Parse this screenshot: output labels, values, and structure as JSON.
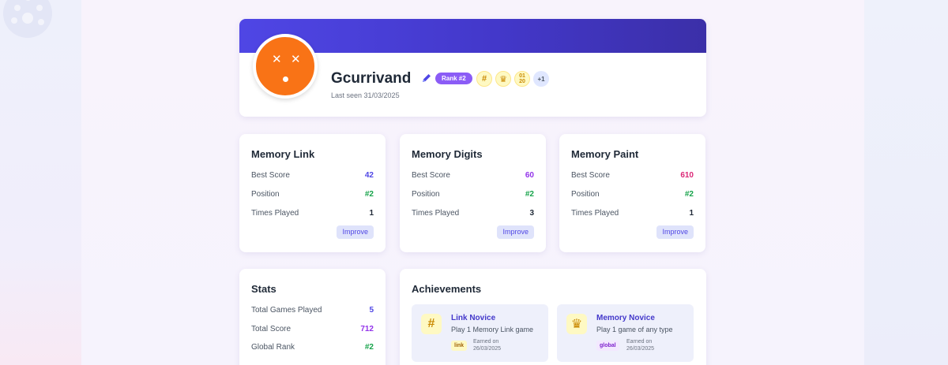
{
  "profile": {
    "username": "Gcurrivand",
    "rank_badge": "Rank #2",
    "last_seen": "Last seen 31/03/2025",
    "more_achievements": "+1",
    "avatar_color": "#f97316",
    "banner_color": "#4f46e5",
    "mini_achievements": [
      "grid-icon",
      "crown-icon",
      "digits-icon"
    ]
  },
  "games": [
    {
      "title": "Memory Link",
      "best_score_label": "Best Score",
      "best_score": "42",
      "best_score_color": "#4f46e5",
      "position_label": "Position",
      "position": "#2",
      "times_played_label": "Times Played",
      "times_played": "1",
      "improve_label": "Improve"
    },
    {
      "title": "Memory Digits",
      "best_score_label": "Best Score",
      "best_score": "60",
      "best_score_color": "#9333ea",
      "position_label": "Position",
      "position": "#2",
      "times_played_label": "Times Played",
      "times_played": "3",
      "improve_label": "Improve"
    },
    {
      "title": "Memory Paint",
      "best_score_label": "Best Score",
      "best_score": "610",
      "best_score_color": "#db2777",
      "position_label": "Position",
      "position": "#2",
      "times_played_label": "Times Played",
      "times_played": "1",
      "improve_label": "Improve"
    }
  ],
  "stats": {
    "title": "Stats",
    "rows": [
      {
        "label": "Total Games Played",
        "value": "5"
      },
      {
        "label": "Total Score",
        "value": "712"
      },
      {
        "label": "Global Rank",
        "value": "#2"
      }
    ]
  },
  "achievements": {
    "title": "Achievements",
    "items": [
      {
        "icon": "grid-icon",
        "name": "Link Novice",
        "description": "Play 1 Memory Link game",
        "tag": "link",
        "earned_label": "Earned on",
        "earned_date": "26/03/2025"
      },
      {
        "icon": "crown-icon",
        "name": "Memory Novice",
        "description": "Play 1 game of any type",
        "tag": "global",
        "earned_label": "Earned on",
        "earned_date": "26/03/2025"
      }
    ]
  },
  "colors": {
    "position": "#16a34a",
    "stat_values": [
      "#4f46e5",
      "#9333ea",
      "#16a34a"
    ]
  }
}
